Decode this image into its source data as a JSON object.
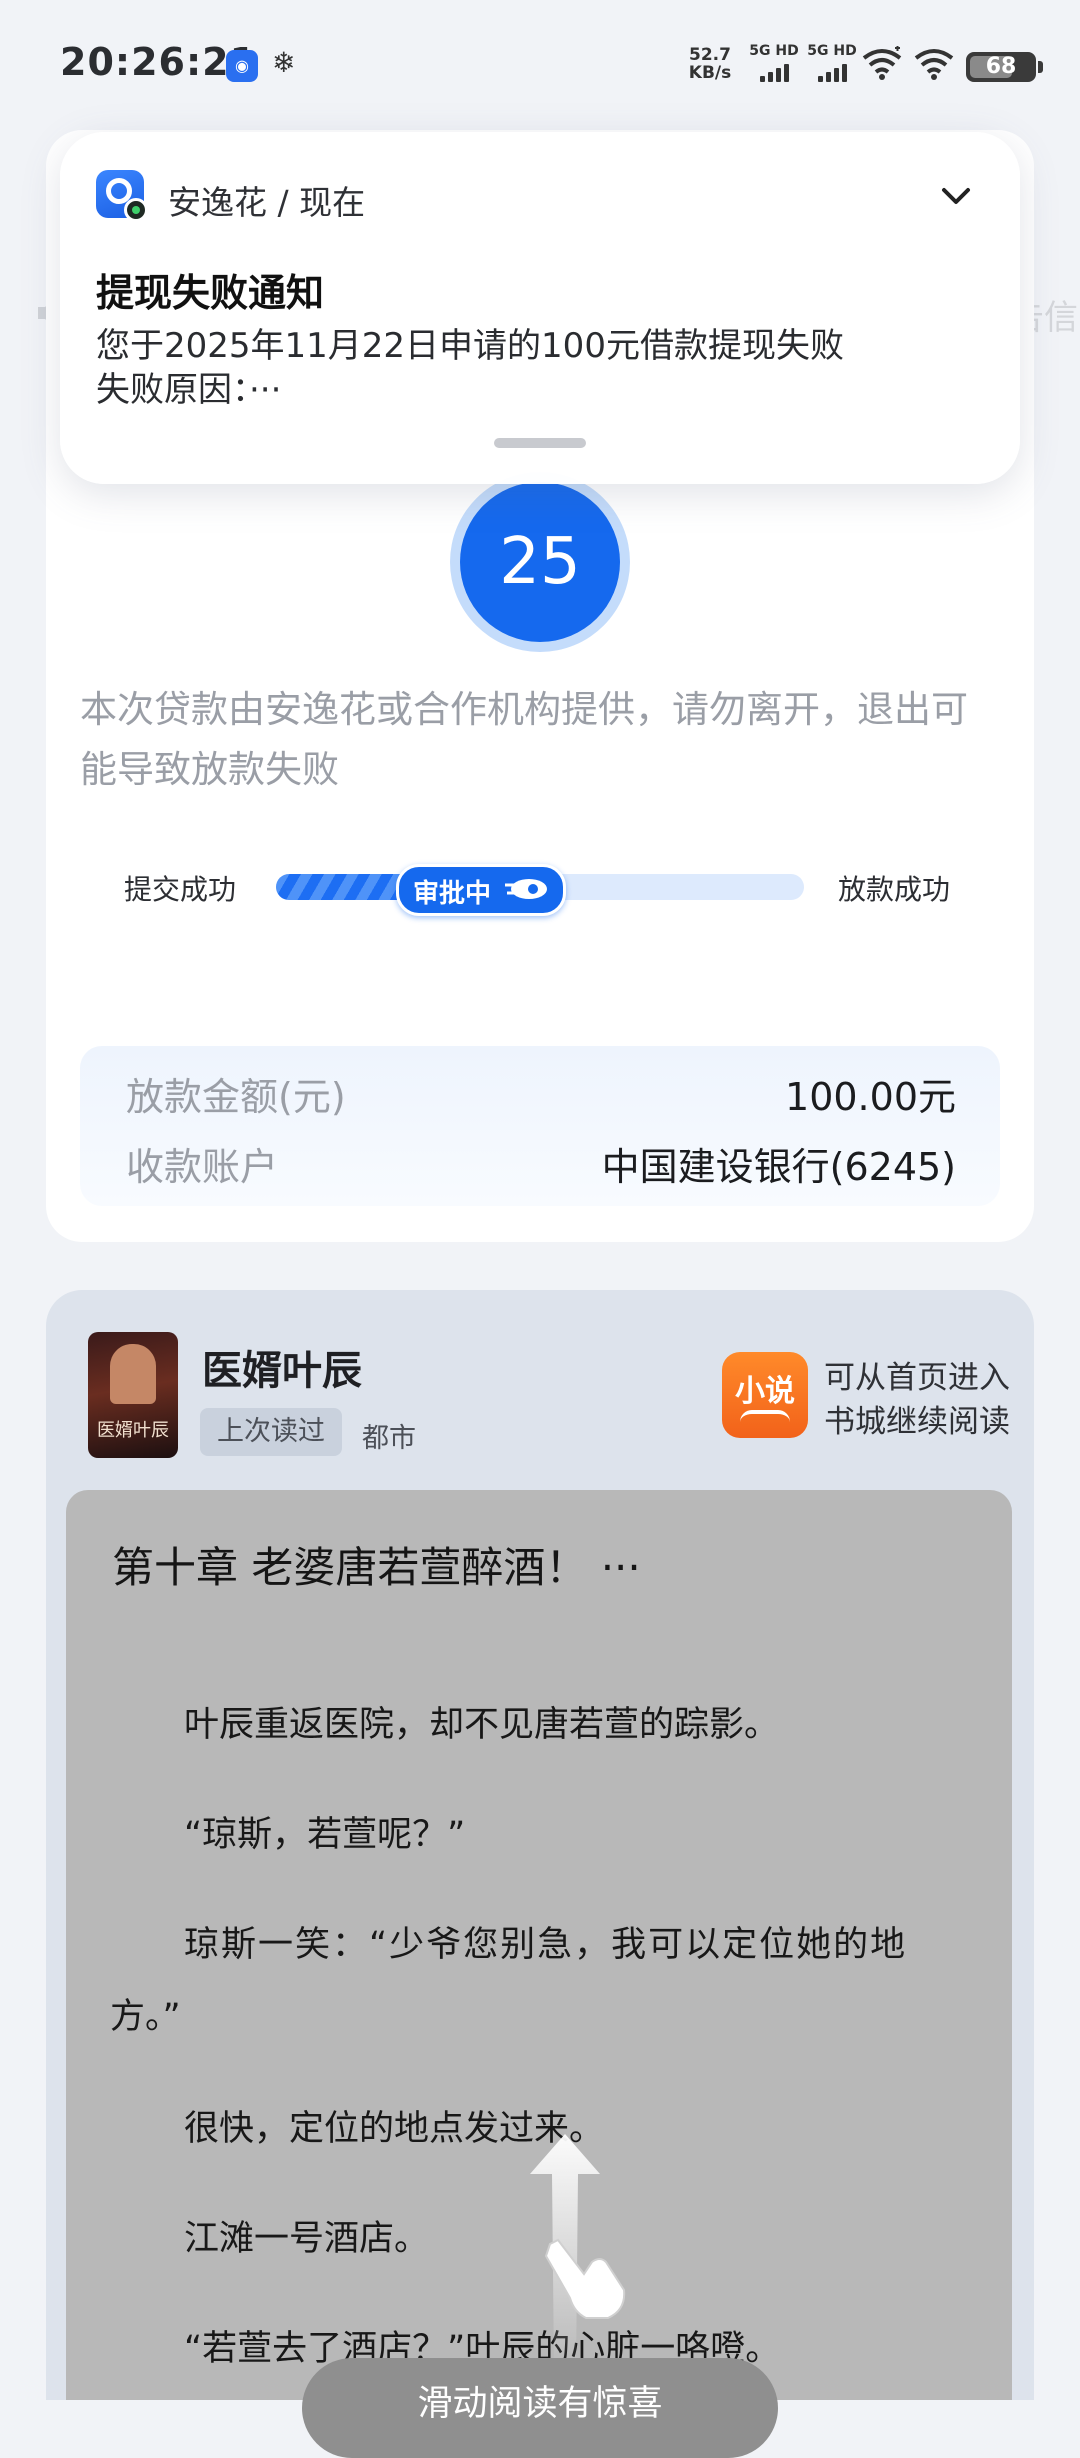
{
  "status_bar": {
    "time": "20:26:21",
    "net_speed_value": "52.7",
    "net_speed_unit": "KB/s",
    "sim1_label": "5G HD",
    "sim2_label": "5G HD",
    "battery": "68",
    "battery_level": 0.68,
    "icons": [
      "app-notification-icon",
      "snowflake-icon",
      "signal-icon",
      "signal-icon",
      "wifi-icon",
      "wifi-icon",
      "battery-icon"
    ]
  },
  "notification": {
    "app": "安逸花 / 现在",
    "title": "提现失败通知",
    "body_line1": "您于2025年11月22日申请的100元借款提现失败",
    "body_line2": "失败原因：···",
    "icons": [
      "app-icon",
      "chevron-down-icon"
    ]
  },
  "edge_text": "告信",
  "loan": {
    "countdown": "25",
    "notice": "本次贷款由安逸花或合作机构提供，请勿离开，退出可能导致放款失败",
    "steps": {
      "submitted": "提交成功",
      "current": "审批中",
      "completed": "放款成功",
      "progress": 0.5
    },
    "amount_label": "放款金额(元)",
    "amount_value": "100.00元",
    "account_label": "收款账户",
    "account_value": "中国建设银行(6245)"
  },
  "novel": {
    "book_title": "医婿叶辰",
    "cover_caption": "医婿叶辰",
    "last_read": "上次读过",
    "genre": "都市",
    "xiaoshuo_logo": "小说",
    "hint_line1": "可从首页进入",
    "hint_line2": "书城继续阅读",
    "chapter_title": "第十章 老婆唐若萱醉酒！ ···",
    "paragraphs": [
      "叶辰重返医院，却不见唐若萱的踪影。",
      "“琼斯，若萱呢？”",
      "琼斯一笑：“少爷您别急，我可以定位她的地",
      "方。”",
      "很快，定位的地点发过来。",
      "江滩一号酒店。",
      "“若萱去了酒店？”叶辰的心脏一咯噔。"
    ],
    "swipe_button": "滑动阅读有惊喜"
  },
  "colors": {
    "primary_blue": "#1569ee",
    "orange": "#f2621a",
    "page_bg": "#f1f3f7"
  }
}
